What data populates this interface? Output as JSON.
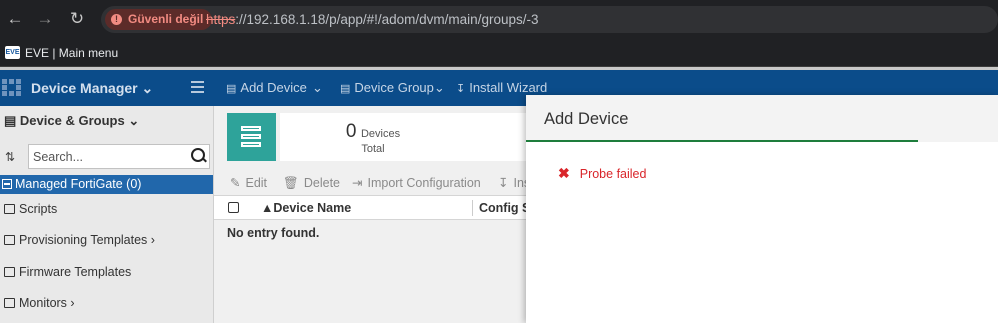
{
  "browser": {
    "security_label": "Güvenli değil",
    "url_scheme": "https",
    "url_rest": "://192.168.1.18/p/app/#!/adom/dvm/main/groups/-3",
    "bookmark_label": "EVE | Main menu"
  },
  "header": {
    "app_title": "Device Manager",
    "toolbar": {
      "add_device": "Add Device",
      "device_group": "Device Group",
      "install_wizard": "Install Wizard"
    }
  },
  "sidebar": {
    "title": "Device & Groups",
    "search_placeholder": "Search...",
    "active_item": "Managed FortiGate (0)",
    "items": [
      "Scripts",
      "Provisioning Templates",
      "Firmware Templates",
      "Monitors"
    ]
  },
  "main": {
    "device_count": "0",
    "device_count_label": "Devices",
    "total_label": "Total",
    "actions": {
      "edit": "Edit",
      "delete": "Delete",
      "import": "Import Configuration",
      "install": "Ins"
    },
    "table": {
      "col_device_name": "Device Name",
      "col_config_status": "Config St"
    },
    "empty_text": "No entry found."
  },
  "dialog": {
    "title": "Add Device",
    "error_text": "Probe failed"
  },
  "colors": {
    "header_bg": "#0b4c8a",
    "active_item_bg": "#2167ab",
    "tile_accent": "#2ea39a",
    "error": "#d9252a",
    "dialog_underline": "#1e7d3c"
  }
}
